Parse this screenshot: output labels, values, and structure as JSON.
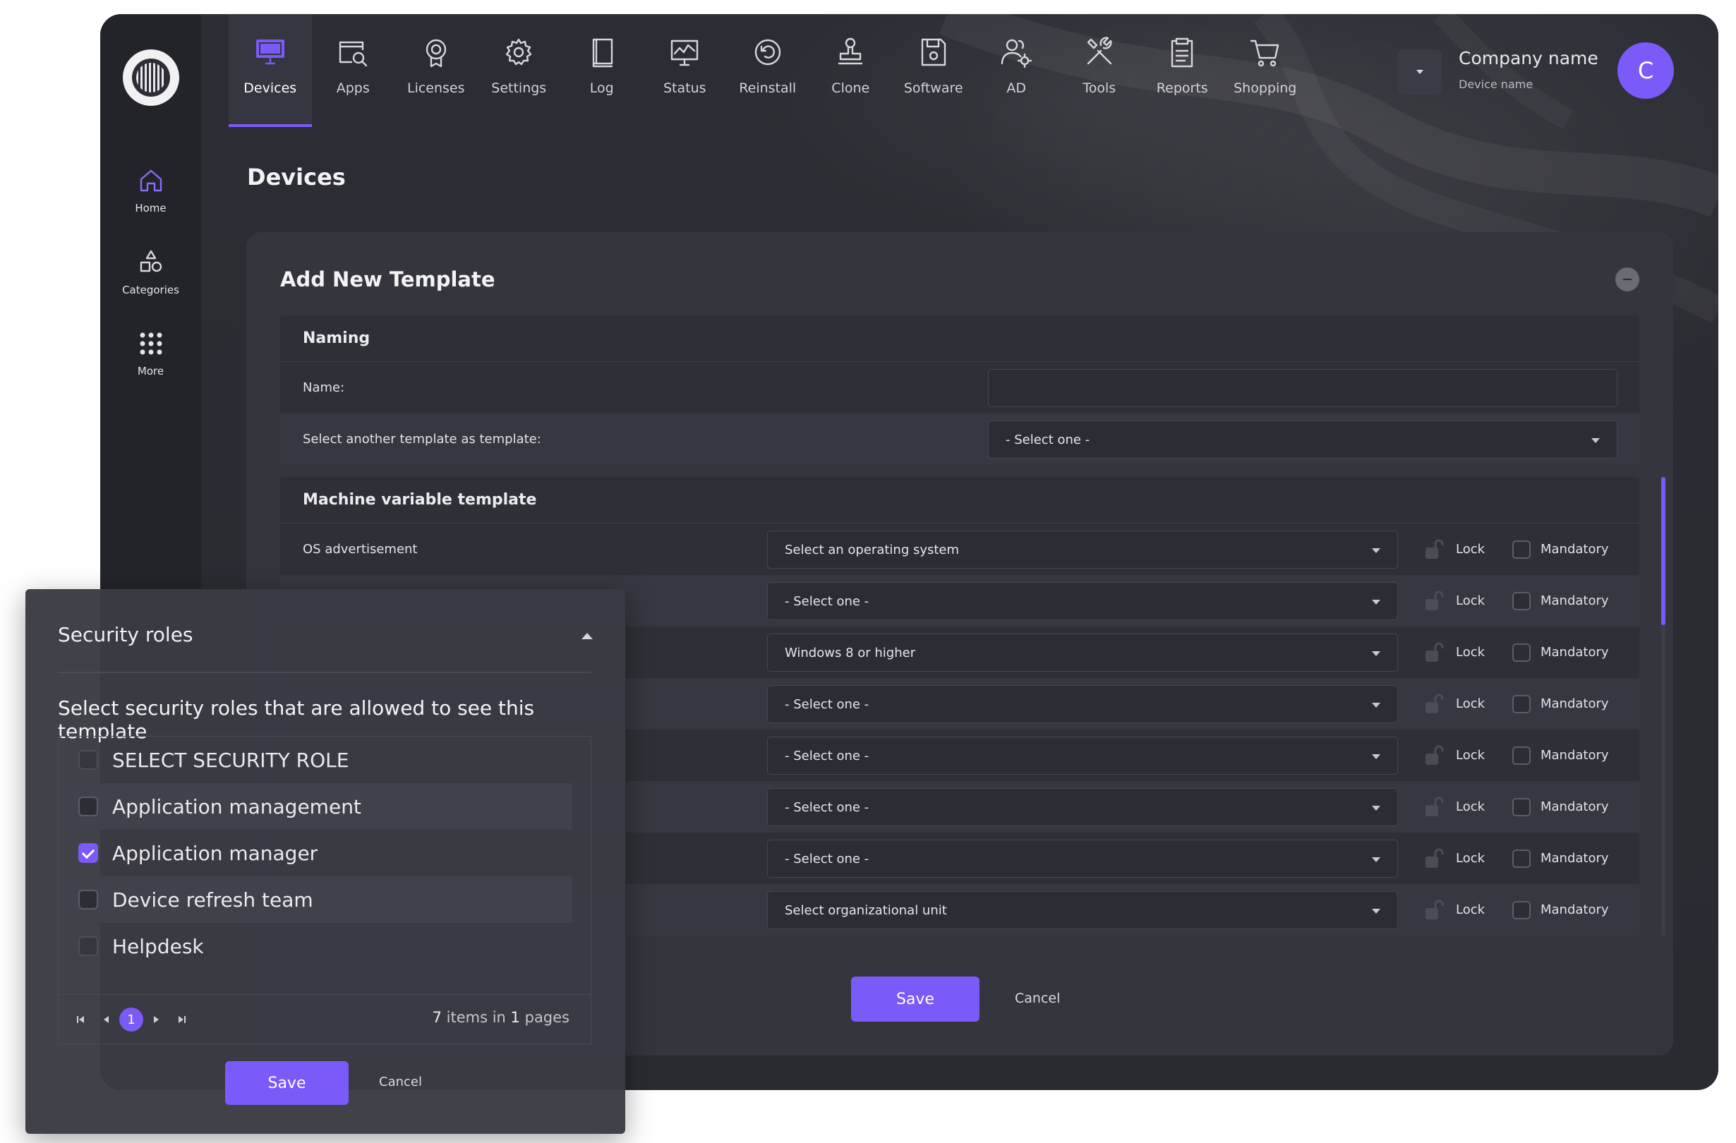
{
  "nav": {
    "items": [
      {
        "label": "Devices",
        "icon": "monitor-icon",
        "active": true
      },
      {
        "label": "Apps",
        "icon": "app-search-icon"
      },
      {
        "label": "Licenses",
        "icon": "license-badge-icon"
      },
      {
        "label": "Settings",
        "icon": "gear-icon"
      },
      {
        "label": "Log",
        "icon": "book-icon"
      },
      {
        "label": "Status",
        "icon": "status-chart-icon"
      },
      {
        "label": "Reinstall",
        "icon": "reinstall-icon"
      },
      {
        "label": "Clone",
        "icon": "stamp-icon"
      },
      {
        "label": "Software",
        "icon": "floppy-disk-icon"
      },
      {
        "label": "AD",
        "icon": "users-gear-icon"
      },
      {
        "label": "Tools",
        "icon": "tools-icon"
      },
      {
        "label": "Reports",
        "icon": "clipboard-icon"
      },
      {
        "label": "Shopping",
        "icon": "cart-icon"
      }
    ]
  },
  "sidebar": {
    "items": [
      {
        "label": "Home",
        "icon": "home-icon"
      },
      {
        "label": "Categories",
        "icon": "shapes-icon"
      },
      {
        "label": "More",
        "icon": "dots-grid-icon"
      }
    ]
  },
  "account": {
    "company_name": "Company name",
    "device_name": "Device name",
    "avatar_initial": "C"
  },
  "page": {
    "title": "Devices"
  },
  "card": {
    "title": "Add New Template",
    "naming": {
      "heading": "Naming",
      "name_label": "Name:",
      "name_value": "",
      "template_label": "Select another template as template:",
      "template_value": "- Select one -"
    },
    "machine": {
      "heading": "Machine variable template",
      "lock_label": "Lock",
      "mandatory_label": "Mandatory",
      "rows": [
        {
          "label": "OS advertisement",
          "value": "Select an operating system"
        },
        {
          "label": "",
          "value": "- Select one -"
        },
        {
          "label": "",
          "value": "Windows 8 or higher"
        },
        {
          "label": "",
          "value": "- Select one -"
        },
        {
          "label": "",
          "value": "- Select one -"
        },
        {
          "label": "",
          "value": "- Select one -"
        },
        {
          "label": "",
          "value": "- Select one -"
        },
        {
          "label": "",
          "value": "Select organizational unit"
        }
      ]
    },
    "save_label": "Save",
    "cancel_label": "Cancel"
  },
  "popup": {
    "title": "Security roles",
    "subtitle": "Select security roles that are allowed to see this template",
    "roles": [
      {
        "label": "SELECT SECURITY ROLE",
        "checked": false
      },
      {
        "label": "Application management",
        "checked": false
      },
      {
        "label": "Application manager",
        "checked": true
      },
      {
        "label": "Device refresh team",
        "checked": false
      },
      {
        "label": "Helpdesk",
        "checked": false
      }
    ],
    "pager": {
      "current_page": "1",
      "total_items": "7",
      "items_in_text": "items in",
      "total_pages": "1",
      "pages_text": "pages"
    },
    "save_label": "Save",
    "cancel_label": "Cancel"
  },
  "colors": {
    "accent": "#7a5af8",
    "background": "#2b2c33",
    "sidebar": "#232429",
    "card": "#34353d"
  }
}
